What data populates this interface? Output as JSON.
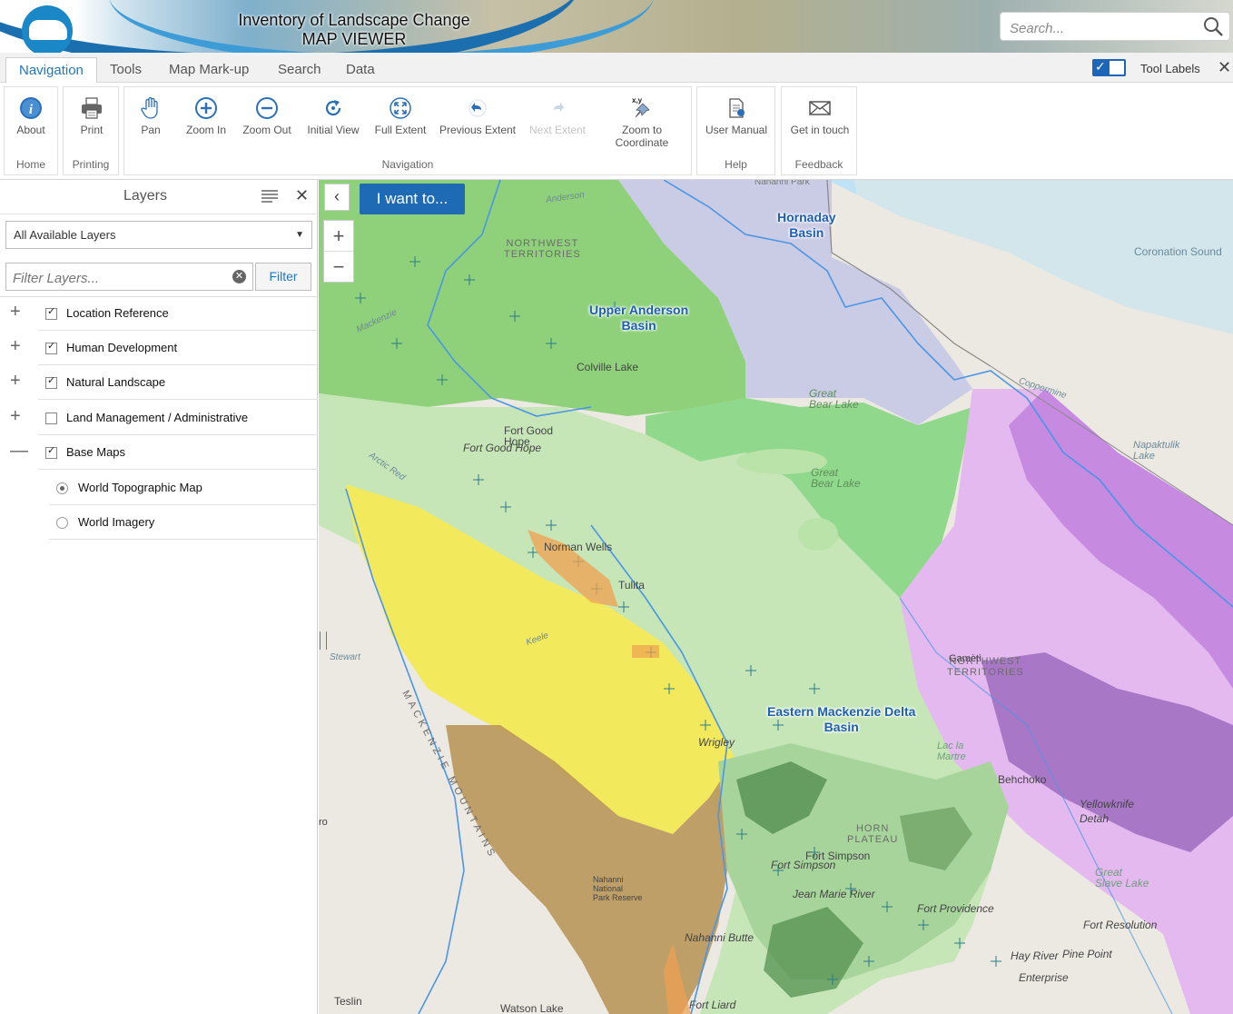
{
  "banner": {
    "title_line1": "Inventory of Landscape Change",
    "title_line2": "MAP VIEWER",
    "search_placeholder": "Search..."
  },
  "tabs": [
    {
      "label": "Navigation",
      "active": true
    },
    {
      "label": "Tools"
    },
    {
      "label": "Map Mark-up"
    },
    {
      "label": "Search"
    },
    {
      "label": "Data"
    }
  ],
  "tool_labels": {
    "label": "Tool Labels",
    "enabled": true
  },
  "ribbon": {
    "groups": {
      "home": "Home",
      "printing": "Printing",
      "navigation": "Navigation",
      "help": "Help",
      "feedback": "Feedback"
    },
    "tools": {
      "about": "About",
      "print": "Print",
      "pan": "Pan",
      "zoom_in": "Zoom In",
      "zoom_out": "Zoom Out",
      "initial_view": "Initial View",
      "full_extent": "Full Extent",
      "previous_extent": "Previous Extent",
      "next_extent": "Next Extent",
      "zoom_coord_line1": "Zoom to",
      "zoom_coord_line2": "Coordinate",
      "user_manual": "User Manual",
      "get_in_touch": "Get in touch"
    }
  },
  "layers": {
    "title": "Layers",
    "select_value": "All Available Layers",
    "filter_placeholder": "Filter Layers...",
    "filter_button": "Filter",
    "items": [
      {
        "label": "Location Reference",
        "checked": true,
        "expanded": false
      },
      {
        "label": "Human Development",
        "checked": true,
        "expanded": false
      },
      {
        "label": "Natural Landscape",
        "checked": true,
        "expanded": false
      },
      {
        "label": "Land Management / Administrative",
        "checked": false,
        "expanded": false
      },
      {
        "label": "Base Maps",
        "checked": true,
        "expanded": true
      }
    ],
    "base_maps": [
      {
        "label": "World Topographic Map",
        "selected": true
      },
      {
        "label": "World Imagery",
        "selected": false
      }
    ]
  },
  "map": {
    "i_want_to": "I want to...",
    "basins": {
      "hornaday_1": "Hornaday",
      "hornaday_2": "Basin",
      "upper_anderson_1": "Upper Anderson",
      "upper_anderson_2": "Basin",
      "eastern_mackenzie_1": "Eastern Mackenzie Delta",
      "eastern_mackenzie_2": "Basin"
    },
    "places": {
      "coronation_sound": "Coronation Sound",
      "colville_lake": "Colville Lake",
      "fort_good_hope_1": "Fort Good",
      "fort_good_hope_2": "Hope",
      "fort_good_hope_it": "Fort Good Hope",
      "great_bear_lake_1a": "Great",
      "great_bear_lake_1b": "Bear Lake",
      "great_bear_lake_2a": "Great",
      "great_bear_lake_2b": "Bear Lake",
      "norman_wells": "Norman Wells",
      "tulita": "Tulita",
      "wrigley": "Wrigley",
      "behchoko": "Behchoko",
      "yellowknife": "Yellowknife",
      "detah": "Detah",
      "fort_simpson": "Fort Simpson",
      "fort_simpson_it": "Fort Simpson",
      "jean_marie": "Jean Marie River",
      "fort_providence": "Fort Providence",
      "fort_resolution": "Fort Resolution",
      "hay_river": "Hay River",
      "pine_point": "Pine Point",
      "enterprise": "Enterprise",
      "great_slave_1": "Great",
      "great_slave_2": "Slave Lake",
      "nahanni_butte": "Nahanni Butte",
      "nahanni_park_1": "Nahanni",
      "nahanni_park_2": "National",
      "nahanni_park_3": "Park Reserve",
      "fort_liard": "Fort Liard",
      "teslin": "Teslin",
      "watson_lake": "Watson Lake",
      "napaktulik_1": "Napaktulik",
      "napaktulik_2": "Lake",
      "lac_la_martre_1": "Lac la",
      "lac_la_martre_2": "Martre",
      "gameti": "Gamètì",
      "coppermine": "Coppermine",
      "anderson": "Anderson",
      "arctic_red": "Arctic Red",
      "stewart": "Stewart",
      "keele": "Keele",
      "mackenzie": "Mackenzie",
      "nahanni_park_top": "Nahanni Park",
      "nwt_1a": "NORTHWEST",
      "nwt_1b": "TERRITORIES",
      "nwt_2a": "NORTHWEST",
      "nwt_2b": "TERRITORIES",
      "mackenzie_mtns": "MACKENZIE MOUNTAINS",
      "horn_plateau_1": "HORN",
      "horn_plateau_2": "PLATEAU",
      "ro": "ro"
    }
  },
  "colors": {
    "accent": "#1e6ab4",
    "tab_active": "#1f76c2",
    "basin_label": "#1d5fb0"
  }
}
